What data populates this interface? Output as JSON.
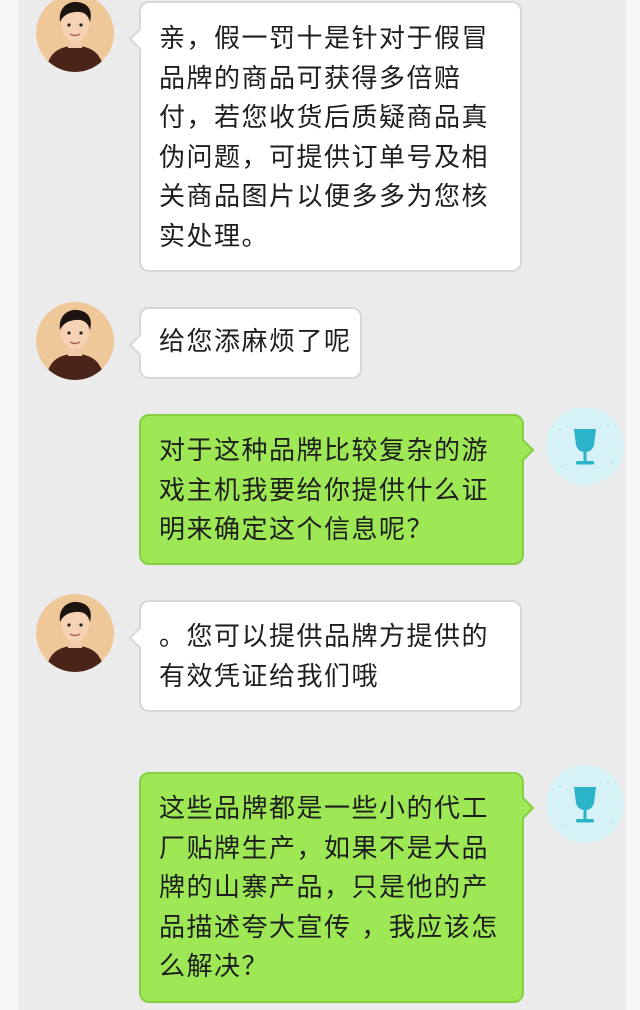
{
  "messages": [
    {
      "sender": "agent",
      "avatar": "person-avatar",
      "lines": [
        "亲，假一罚十是针对于假冒",
        "品牌的商品可获得多倍赔",
        "付，若您收货后质疑商品真",
        "伪问题，可提供订单号及相",
        "关商品图片以便多多为您核",
        "实处理。"
      ]
    },
    {
      "sender": "agent",
      "avatar": "person-avatar",
      "lines": [
        "给您添麻烦了呢"
      ]
    },
    {
      "sender": "user",
      "avatar": "wine-glass-avatar",
      "lines": [
        "对于这种品牌比较复杂的游",
        "戏主机我要给你提供什么证",
        "明来确定这个信息呢？"
      ]
    },
    {
      "sender": "agent",
      "avatar": "person-avatar",
      "lines": [
        "。您可以提供品牌方提供的",
        "有效凭证给我们哦"
      ]
    },
    {
      "sender": "user",
      "avatar": "wine-glass-avatar",
      "lines": [
        "这些品牌都是一些小的代工",
        "厂贴牌生产，如果不是大品",
        "牌的山寨产品，只是他的产",
        "品描述夸大宣传 ，我应该怎",
        "么解决？"
      ]
    }
  ],
  "colors": {
    "background": "#ebebeb",
    "agent_bubble": "#ffffff",
    "user_bubble": "#9ee855",
    "user_avatar_bg": "#d7f2f6",
    "wine_glass": "#2ab3c9"
  }
}
